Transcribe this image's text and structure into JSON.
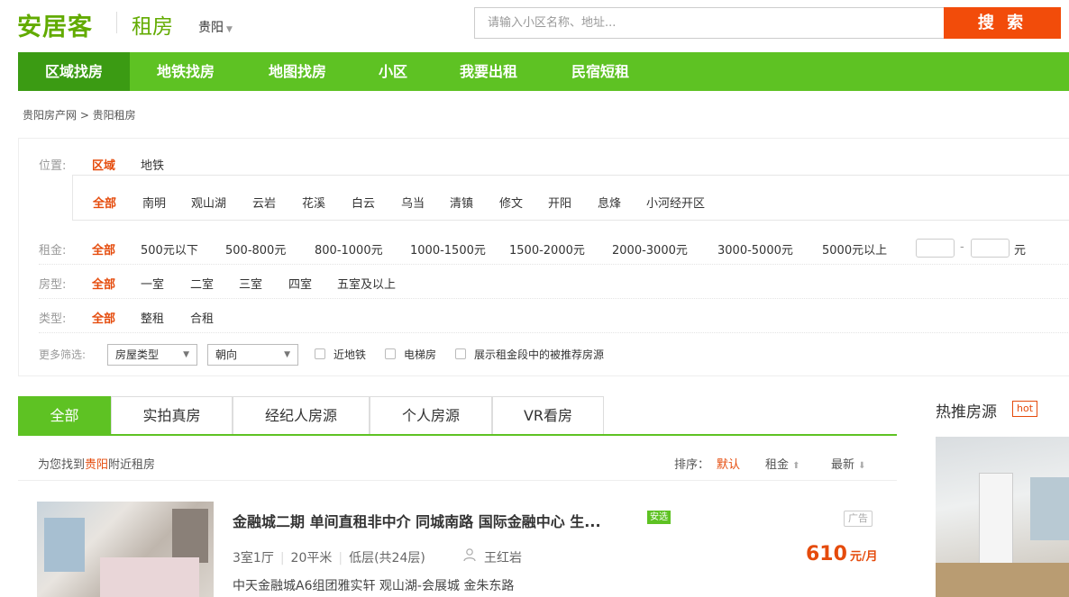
{
  "header": {
    "logo": "安居客",
    "section": "租房",
    "city": "贵阳",
    "search_placeholder": "请输入小区名称、地址...",
    "search_button": "搜 索"
  },
  "nav": [
    "区域找房",
    "地铁找房",
    "地图找房",
    "小区",
    "我要出租",
    "民宿短租"
  ],
  "breadcrumb": "贵阳房产网 > 贵阳租房",
  "filters": {
    "position_label": "位置:",
    "position_tabs": [
      "区域",
      "地铁"
    ],
    "districts": [
      "全部",
      "南明",
      "观山湖",
      "云岩",
      "花溪",
      "白云",
      "乌当",
      "清镇",
      "修文",
      "开阳",
      "息烽",
      "小河经开区"
    ],
    "rent_label": "租金:",
    "rents": [
      "全部",
      "500元以下",
      "500-800元",
      "800-1000元",
      "1000-1500元",
      "1500-2000元",
      "2000-3000元",
      "3000-5000元",
      "5000元以上"
    ],
    "rent_dash": "-",
    "rent_unit": "元",
    "rooms_label": "房型:",
    "rooms": [
      "全部",
      "一室",
      "二室",
      "三室",
      "四室",
      "五室及以上"
    ],
    "type_label": "类型:",
    "types": [
      "全部",
      "整租",
      "合租"
    ],
    "more_label": "更多筛选:",
    "select_house_type": "房屋类型",
    "select_orientation": "朝向",
    "check_subway": "近地铁",
    "check_elevator": "电梯房",
    "check_recommend": "展示租金段中的被推荐房源"
  },
  "tabs": [
    "全部",
    "实拍真房",
    "经纪人房源",
    "个人房源",
    "VR看房"
  ],
  "results": {
    "prefix": "为您找到",
    "city": "贵阳",
    "suffix": "附近租房",
    "sort_label": "排序：",
    "sort_default": "默认",
    "sort_rent": "租金",
    "sort_latest": "最新"
  },
  "listing": {
    "title": "金融城二期 单间直租非中介 同城南路 国际金融中心 生...",
    "badge": "安选",
    "ad": "广告",
    "layout": "3室1厅",
    "area": "20平米",
    "floor": "低层(共24层)",
    "agent": "王红岩",
    "price": "610",
    "price_unit": "元/月",
    "address": "中天金融城A6组团雅实轩   观山湖-会展城 金朱东路"
  },
  "hot": {
    "title": "热推房源",
    "badge": "hot"
  },
  "colors": {
    "green": "#5ec223",
    "dark_green": "#3b9b13",
    "orange": "#e54b0c",
    "search_orange": "#f24c0a"
  }
}
